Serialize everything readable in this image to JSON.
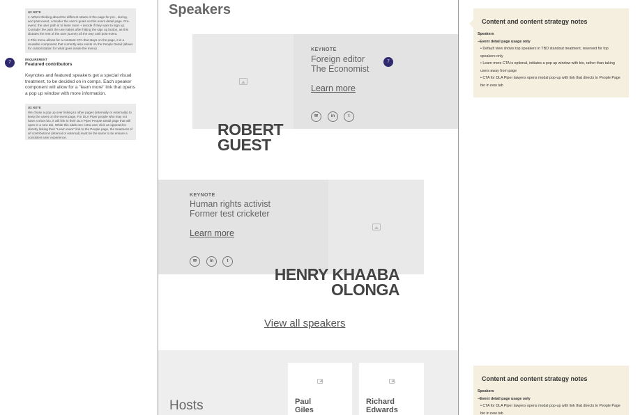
{
  "left_panel": {
    "ux_note_1": {
      "label": "UX NOTE",
      "paragraphs": [
        "1. When thinking about the different states of the page for pre-, during, and post-event, consider the user's goals on this event detail page. Pre-event, the user path is to learn more + decide if they want to sign up. Consider the path the user takes after hitting the sign up button, as this dictates the rest of the user journey all the way until post-event.",
        "2.This menu allows for a constant CTA that stays on the page, it is a reusable component that currently also exists on the People Detail (allows for customization for what goes inside the menu)"
      ]
    },
    "badge_number": "7",
    "requirement": {
      "label": "REQUIREMENT",
      "title": "Featured contributors",
      "body": "Keynotes and featured speakers get a special visual treatment, to be decided on in comps. Each speaker component will allow for a \"learn more\" link that opens a pop up window with more information."
    },
    "ux_note_2": {
      "label": "UX NOTE",
      "text": "We chose a pop up over linking to other pages (internally or externally) to keep the users on the event page. For DLA Piper people who may not have a short bio, it will link to their DLA Piper People Detail page that will open in a new tab. While this adds one extra user click as opposed to directly linking their \"Learn more\" link to the People page, the treatment of all contributions (internal or external) must be the same to be ensure a consistent user experience."
    }
  },
  "main": {
    "section_title": "Speakers",
    "speakers": [
      {
        "tag": "KEYNOTE",
        "role_line1": "Foreign editor",
        "role_line2": "The Economist",
        "learn_more": "Learn more",
        "name_line1": "ROBERT",
        "name_line2": "GUEST",
        "badge": "7"
      },
      {
        "tag": "KEYNOTE",
        "role_line1": "Human rights activist",
        "role_line2": "Former test cricketer",
        "learn_more": "Learn more",
        "name_line1": "HENRY KHAABA",
        "name_line2": "OLONGA"
      }
    ],
    "social_icons": [
      "mail-icon",
      "linkedin-icon",
      "twitter-icon"
    ],
    "view_all": "View all speakers",
    "hosts_title": "Hosts",
    "hosts": [
      {
        "first": "Paul",
        "last": "Giles"
      },
      {
        "first": "Richard",
        "last": "Edwards"
      }
    ]
  },
  "notes": [
    {
      "title": "Content and content strategy notes",
      "lines": [
        "Speakers",
        "–Event detail page usage only",
        "• Default view shows top speakers in TBD standout treatment, reserved for top speakers only",
        "• Learn more CTA is optional, initiates a pop up window with bio, rather than taking users away from page",
        "• CTA for DLA Piper lawyers opens modal pop-up with link that directs to People Page bio in new tab"
      ]
    },
    {
      "title": "Content and content strategy notes",
      "lines": [
        "Speakers",
        "–Event detail page usage only",
        "• CTA for DLA Piper lawyers opens modal pop-up with link that directs to People Page bio in new tab"
      ]
    }
  ],
  "colors": {
    "badge": "#2f2a6e",
    "note_bg": "#f5efdf",
    "card_bg": "#e3e3e3"
  }
}
